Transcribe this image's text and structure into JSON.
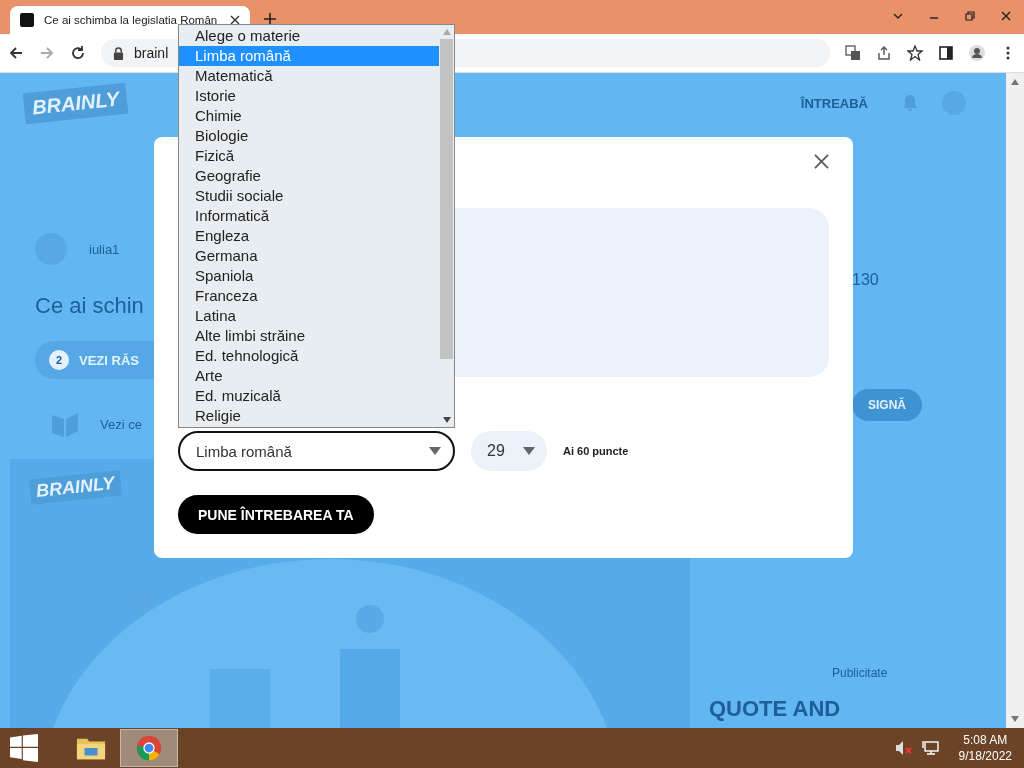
{
  "browser": {
    "tab_title": "Ce ai schimba la legislatia Român",
    "address": "brainl"
  },
  "page": {
    "logo": "BRAINLY",
    "ask": "ÎNTREABĂ",
    "question": {
      "author": "iulia1",
      "title": "Ce ai schin",
      "answers_count": "2",
      "answers_button": "VEZI RĂS",
      "hint": "Vezi ce"
    },
    "side": {
      "points": "130",
      "button": "SIGNĂ",
      "ad_label": "Publicitate",
      "ad_headline": "QUOTE AND"
    },
    "banner_logo": "BRAINLY"
  },
  "dialog": {
    "subject_field": {
      "value": "Limba română",
      "expanded": true
    },
    "subject_options": [
      {
        "label": "Alege o materie",
        "selected": false
      },
      {
        "label": "Limba română",
        "selected": true
      },
      {
        "label": "Matematică",
        "selected": false
      },
      {
        "label": "Istorie",
        "selected": false
      },
      {
        "label": "Chimie",
        "selected": false
      },
      {
        "label": "Biologie",
        "selected": false
      },
      {
        "label": "Fizică",
        "selected": false
      },
      {
        "label": "Geografie",
        "selected": false
      },
      {
        "label": "Studii sociale",
        "selected": false
      },
      {
        "label": "Informatică",
        "selected": false
      },
      {
        "label": "Engleza",
        "selected": false
      },
      {
        "label": "Germana",
        "selected": false
      },
      {
        "label": "Spaniola",
        "selected": false
      },
      {
        "label": "Franceza",
        "selected": false
      },
      {
        "label": "Latina",
        "selected": false
      },
      {
        "label": "Alte limbi străine",
        "selected": false
      },
      {
        "label": "Ed. tehnologică",
        "selected": false
      },
      {
        "label": "Arte",
        "selected": false
      },
      {
        "label": "Ed. muzicală",
        "selected": false
      },
      {
        "label": "Religie",
        "selected": false
      }
    ],
    "points_field": {
      "value": "29"
    },
    "points_note": "Ai 60 puncte",
    "submit": "PUNE ÎNTREBAREA TA"
  },
  "taskbar": {
    "time": "5:08 AM",
    "date": "9/18/2022"
  }
}
